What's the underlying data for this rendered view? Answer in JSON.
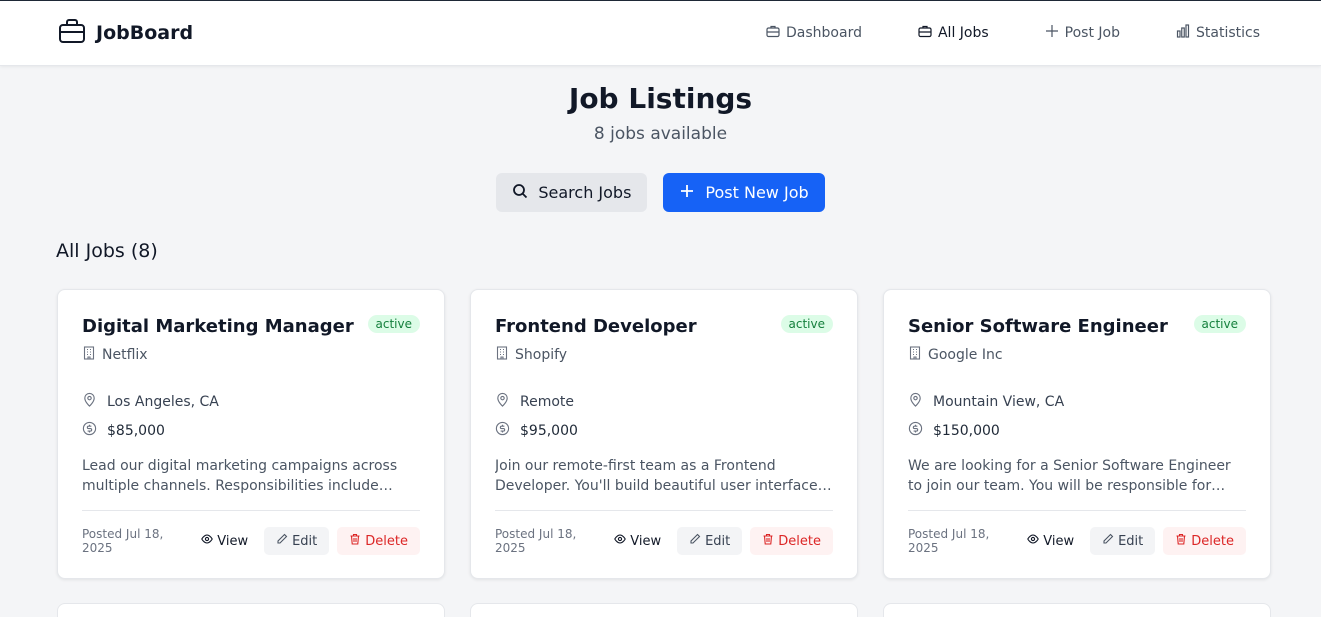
{
  "brand": {
    "name": "JobBoard",
    "icon": "briefcase-icon"
  },
  "nav": [
    {
      "label": "Dashboard",
      "icon": "briefcase-icon",
      "active": false
    },
    {
      "label": "All Jobs",
      "icon": "briefcase-icon",
      "active": true
    },
    {
      "label": "Post Job",
      "icon": "plus-icon",
      "active": false
    },
    {
      "label": "Statistics",
      "icon": "bar-chart-icon",
      "active": false
    }
  ],
  "hero": {
    "title": "Job Listings",
    "subtitle": "8 jobs available",
    "search_label": "Search Jobs",
    "post_label": "Post New Job"
  },
  "section": {
    "title": "All Jobs (8)"
  },
  "jobs": [
    {
      "title": "Digital Marketing Manager",
      "status": "active",
      "company": "Netflix",
      "location": "Los Angeles, CA",
      "salary": "$85,000",
      "description": "Lead our digital marketing campaigns across multiple channels. Responsibilities include social media management and campaign analytics.",
      "posted": "Posted Jul 18, 2025"
    },
    {
      "title": "Frontend Developer",
      "status": "active",
      "company": "Shopify",
      "location": "Remote",
      "salary": "$95,000",
      "description": "Join our remote-first team as a Frontend Developer. You'll build beautiful user interfaces using React, TypeScript and modern tooling.",
      "posted": "Posted Jul 18, 2025"
    },
    {
      "title": "Senior Software Engineer",
      "status": "active",
      "company": "Google Inc",
      "location": "Mountain View, CA",
      "salary": "$150,000",
      "description": "We are looking for a Senior Software Engineer to join our team. You will be responsible for developing scalable systems.",
      "posted": "Posted Jul 18, 2025"
    }
  ],
  "card_actions": {
    "view": "View",
    "edit": "Edit",
    "delete": "Delete"
  },
  "colors": {
    "primary": "#1662f6",
    "badge_bg": "#dcfce7",
    "badge_text": "#15803d",
    "delete_text": "#dc2626"
  }
}
